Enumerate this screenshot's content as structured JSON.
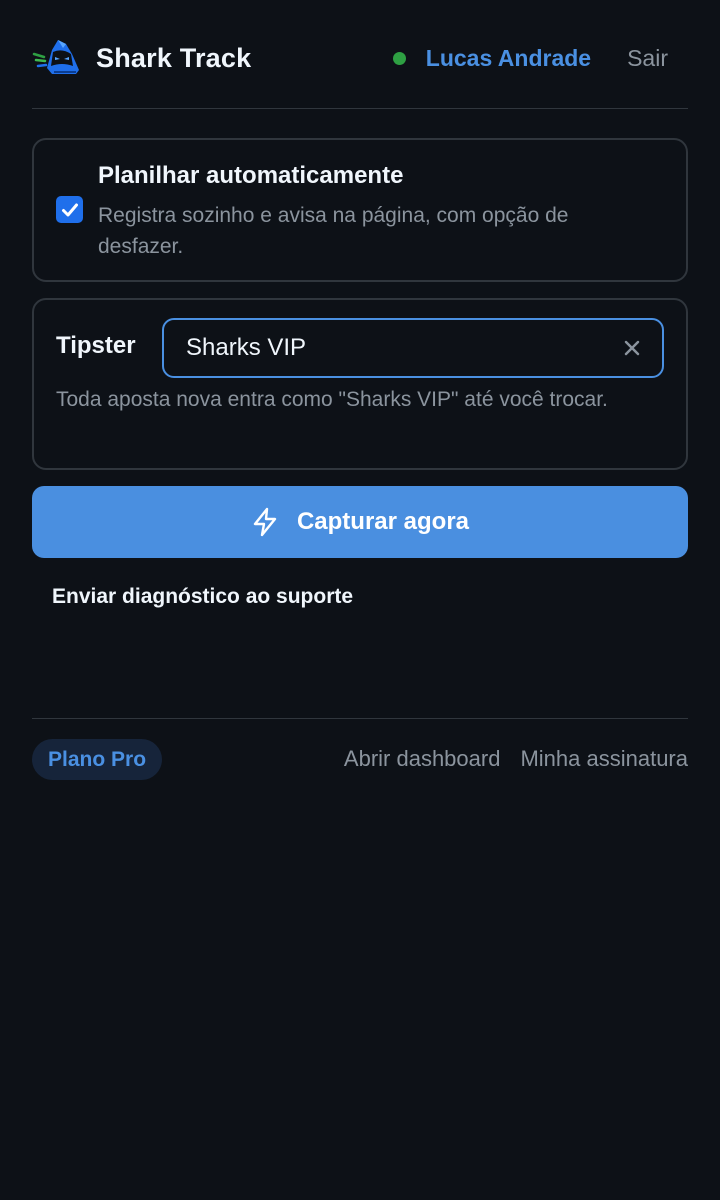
{
  "header": {
    "brand": "Shark Track",
    "user_name": "Lucas Andrade",
    "logout_label": "Sair",
    "status": "online"
  },
  "auto_capture": {
    "checked": true,
    "title": "Planilhar automaticamente",
    "description": "Registra sozinho e avisa na página, com opção de desfazer."
  },
  "tipster": {
    "label": "Tipster",
    "value": "Sharks VIP",
    "hint": "Toda aposta nova entra como \"Sharks VIP\" até você trocar."
  },
  "actions": {
    "capture_label": "Capturar agora",
    "diagnostic_label": "Enviar diagnóstico ao suporte"
  },
  "footer": {
    "plan_badge": "Plano Pro",
    "dashboard_link": "Abrir dashboard",
    "subscription_link": "Minha assinatura"
  },
  "colors": {
    "background": "#0d1117",
    "accent": "#4a90e2",
    "status_online": "#2ea043",
    "checkbox": "#1f6feb"
  },
  "icons": {
    "logo": "shark-logo-icon",
    "checkbox": "check-icon",
    "clear": "close-icon",
    "capture": "lightning-icon"
  }
}
